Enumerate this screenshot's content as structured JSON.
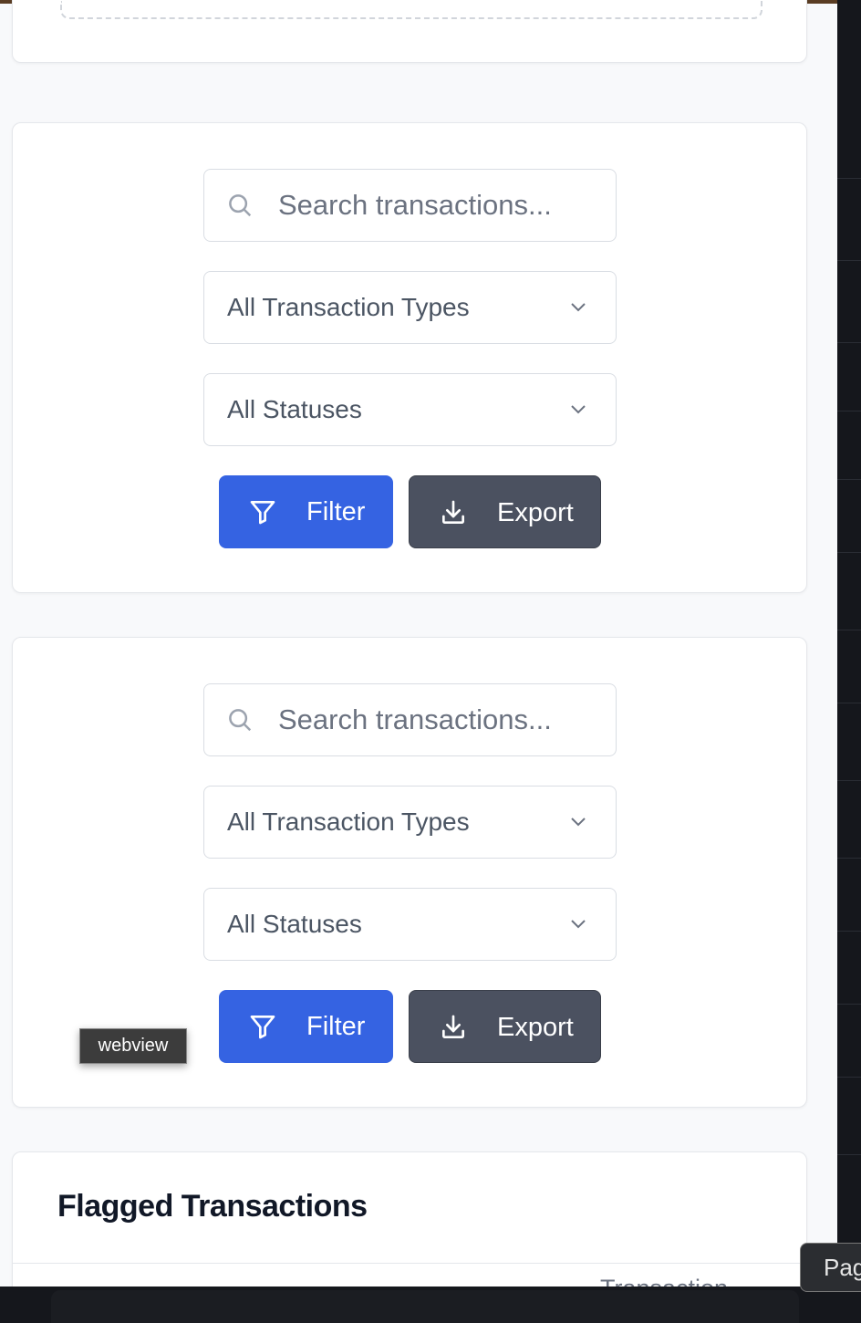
{
  "filter_panels": [
    {
      "search_placeholder": "Search transactions...",
      "type_select": "All Transaction Types",
      "status_select": "All Statuses",
      "filter_label": "Filter",
      "export_label": "Export"
    },
    {
      "search_placeholder": "Search transactions...",
      "type_select": "All Transaction Types",
      "status_select": "All Statuses",
      "filter_label": "Filter",
      "export_label": "Export"
    }
  ],
  "tooltip": "webview",
  "flagged": {
    "title": "Flagged Transactions",
    "column_header": "Transaction"
  },
  "pager_tooltip": "Pag",
  "colors": {
    "primary": "#3563e2",
    "secondary": "#4b5160",
    "text": "#111827",
    "muted": "#6b7280"
  },
  "icons": [
    "search-icon",
    "chevron-down-icon",
    "funnel-icon",
    "download-icon"
  ]
}
